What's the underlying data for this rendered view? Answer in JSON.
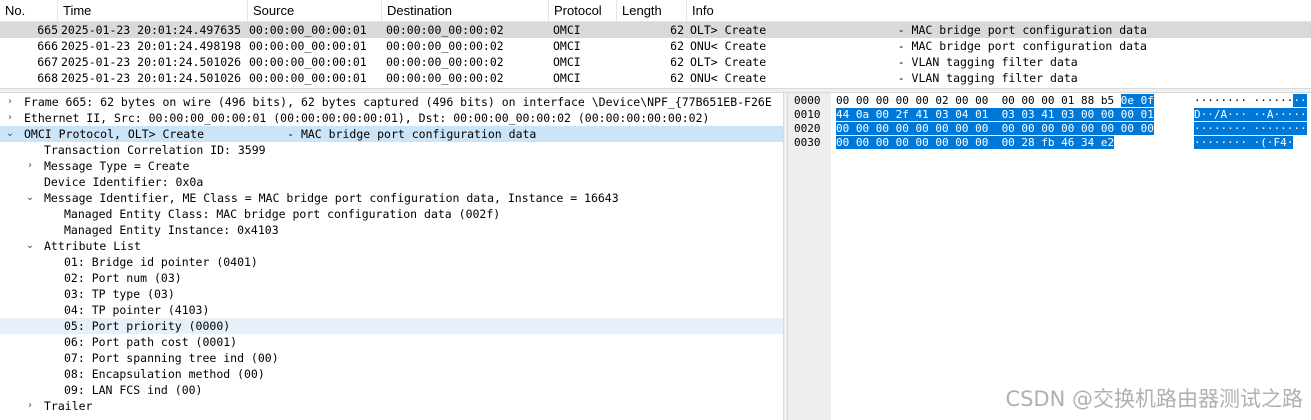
{
  "columns": [
    "No.",
    "Time",
    "Source",
    "Destination",
    "Protocol",
    "Length",
    "Info"
  ],
  "packets": [
    {
      "no": "665",
      "time": "2025-01-23 20:01:24.497635",
      "src": "00:00:00_00:00:01",
      "dst": "00:00:00_00:00:02",
      "proto": "OMCI",
      "len": "62",
      "info": "OLT> Create                   - MAC bridge port configuration data"
    },
    {
      "no": "666",
      "time": "2025-01-23 20:01:24.498198",
      "src": "00:00:00_00:00:01",
      "dst": "00:00:00_00:00:02",
      "proto": "OMCI",
      "len": "62",
      "info": "ONU< Create                   - MAC bridge port configuration data"
    },
    {
      "no": "667",
      "time": "2025-01-23 20:01:24.501026",
      "src": "00:00:00_00:00:01",
      "dst": "00:00:00_00:00:02",
      "proto": "OMCI",
      "len": "62",
      "info": "OLT> Create                   - VLAN tagging filter data"
    },
    {
      "no": "668",
      "time": "2025-01-23 20:01:24.501026",
      "src": "00:00:00_00:00:01",
      "dst": "00:00:00_00:00:02",
      "proto": "OMCI",
      "len": "62",
      "info": "ONU< Create                   - VLAN tagging filter data"
    }
  ],
  "tree": [
    {
      "arrow": "right",
      "text": "Frame 665: 62 bytes on wire (496 bits), 62 bytes captured (496 bits) on interface \\Device\\NPF_{77B651EB-F26E"
    },
    {
      "arrow": "right",
      "text": "Ethernet II, Src: 00:00:00_00:00:01 (00:00:00:00:00:01), Dst: 00:00:00_00:00:02 (00:00:00:00:00:02)"
    },
    {
      "arrow": "down",
      "text": "OMCI Protocol, OLT> Create            - MAC bridge port configuration data"
    },
    {
      "arrow": "none",
      "text": "Transaction Correlation ID: 3599"
    },
    {
      "arrow": "right",
      "text": "Message Type = Create"
    },
    {
      "arrow": "none",
      "text": "Device Identifier: 0x0a"
    },
    {
      "arrow": "down",
      "text": "Message Identifier, ME Class = MAC bridge port configuration data, Instance = 16643"
    },
    {
      "arrow": "none",
      "text": "Managed Entity Class: MAC bridge port configuration data (002f)"
    },
    {
      "arrow": "none",
      "text": "Managed Entity Instance: 0x4103"
    },
    {
      "arrow": "down",
      "text": "Attribute List"
    },
    {
      "arrow": "none",
      "text": "01: Bridge id pointer (0401)"
    },
    {
      "arrow": "none",
      "text": "02: Port num (03)"
    },
    {
      "arrow": "none",
      "text": "03: TP type (03)"
    },
    {
      "arrow": "none",
      "text": "04: TP pointer (4103)"
    },
    {
      "arrow": "none",
      "text": "05: Port priority (0000)"
    },
    {
      "arrow": "none",
      "text": "06: Port path cost (0001)"
    },
    {
      "arrow": "none",
      "text": "07: Port spanning tree ind (00)"
    },
    {
      "arrow": "none",
      "text": "08: Encapsulation method (00)"
    },
    {
      "arrow": "none",
      "text": "09: LAN FCS ind (00)"
    },
    {
      "arrow": "right",
      "text": "Trailer"
    }
  ],
  "bytes": [
    {
      "offset": "0000",
      "hex": "00 00 00 00 00 02 00 00  00 00 00 01 88 b5 ",
      "hex_hl": "0e 0f",
      "ascii": "········ ······",
      "ascii_hl": "··"
    },
    {
      "offset": "0010",
      "hex": "",
      "hex_hl": "44 0a 00 2f 41 03 04 01  03 03 41 03 00 00 00 01",
      "ascii": "",
      "ascii_hl": "D··/A··· ··A·····"
    },
    {
      "offset": "0020",
      "hex": "",
      "hex_hl": "00 00 00 00 00 00 00 00  00 00 00 00 00 00 00 00",
      "ascii": "",
      "ascii_hl": "········ ········"
    },
    {
      "offset": "0030",
      "hex": "",
      "hex_hl": "00 00 00 00 00 00 00 00  00 28 fb 46 34 e2",
      "ascii": "",
      "ascii_hl": "········ ·(·F4·"
    }
  ],
  "watermark": "CSDN @交换机路由器测试之路"
}
